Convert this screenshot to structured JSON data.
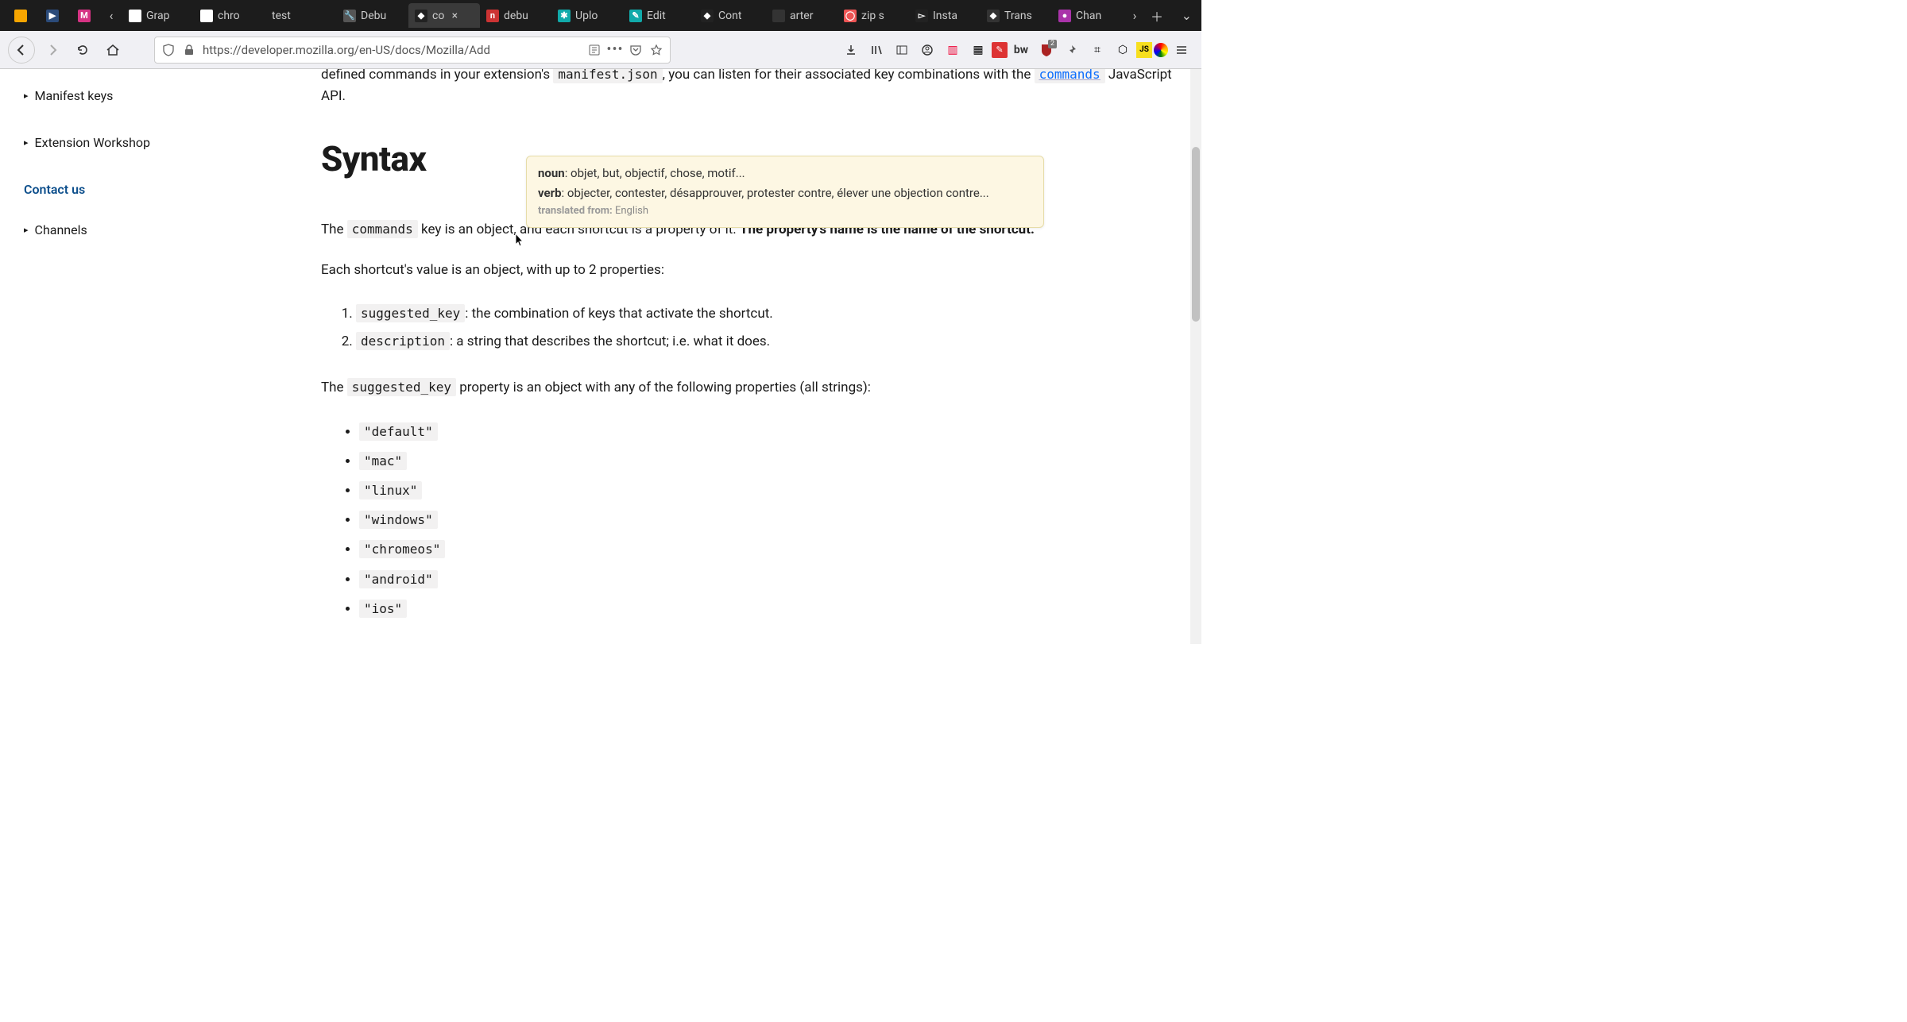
{
  "os_tabs": {
    "pinned": [
      {
        "color": "#f7a500",
        "txt": ""
      },
      {
        "color": "#2b4b7a",
        "txt": "▶"
      },
      {
        "color": "#d63384",
        "txt": "M"
      }
    ],
    "items": [
      {
        "label": "Grap",
        "fav_bg": "#fff",
        "fav_txt": "‹",
        "active": false,
        "closable": false
      },
      {
        "label": "chro",
        "fav_bg": "#fff",
        "fav_txt": "◉",
        "active": false,
        "closable": false
      },
      {
        "label": "test",
        "fav_bg": "",
        "fav_txt": "",
        "active": false,
        "closable": false
      },
      {
        "label": "Debu",
        "fav_bg": "#555",
        "fav_txt": "🔧",
        "active": false,
        "closable": false
      },
      {
        "label": "co",
        "fav_bg": "#222",
        "fav_txt": "◆",
        "active": true,
        "closable": true
      },
      {
        "label": "debu",
        "fav_bg": "#c33",
        "fav_txt": "n",
        "active": false,
        "closable": false
      },
      {
        "label": "Uplo",
        "fav_bg": "#1aa",
        "fav_txt": "✱",
        "active": false,
        "closable": false
      },
      {
        "label": "Edit",
        "fav_bg": "#1aa",
        "fav_txt": "✎",
        "active": false,
        "closable": false
      },
      {
        "label": "Cont",
        "fav_bg": "#222",
        "fav_txt": "◆",
        "active": false,
        "closable": false
      },
      {
        "label": "arter",
        "fav_bg": "#333",
        "fav_txt": "",
        "active": false,
        "closable": false
      },
      {
        "label": "zip s",
        "fav_bg": "#e55",
        "fav_txt": "◯",
        "active": false,
        "closable": false
      },
      {
        "label": "Insta",
        "fav_bg": "#222",
        "fav_txt": "▻",
        "active": false,
        "closable": false
      },
      {
        "label": "Trans",
        "fav_bg": "#333",
        "fav_txt": "◆",
        "active": false,
        "closable": false
      },
      {
        "label": "Chan",
        "fav_bg": "#a3a",
        "fav_txt": "●",
        "active": false,
        "closable": false
      }
    ],
    "overflow_next": "›",
    "new_tab": "＋",
    "dropdown": "⌄"
  },
  "toolbar": {
    "url": "https://developer.mozilla.org/en-US/docs/Mozilla/Add",
    "back": "←",
    "forward": "→",
    "reload": "⟳",
    "home": "⌂",
    "shield": "⛉",
    "lock": "🔒",
    "reader": "☰",
    "ellipsis": "⋯",
    "pocket": "⌄",
    "bookmark": "☆",
    "download": "⬇",
    "library": "⫿",
    "sidebar": "▭",
    "account": "◯",
    "ext_badge": "2"
  },
  "sidebar": {
    "items": [
      {
        "label": "Manifest keys",
        "chev": "▸",
        "link": false
      },
      {
        "label": "Extension Workshop",
        "chev": "▸",
        "link": false
      },
      {
        "label": "Contact us",
        "chev": "",
        "link": true
      },
      {
        "label": "Channels",
        "chev": "▸",
        "link": false
      }
    ]
  },
  "content": {
    "partial_pre": "defined commands in your extension's ",
    "partial_code": "manifest.json",
    "partial_mid": ", you can listen for their associated key combinations with the ",
    "partial_link_code": "commands",
    "partial_post": " JavaScript API.",
    "heading": "Syntax",
    "p1_pre": "The ",
    "p1_code": "commands",
    "p1_mid": " key is an object, and each shortcut is a property of it. ",
    "p1_strong": "The property's name is the name of the shortcut.",
    "p2": "Each shortcut's value is an object, with up to 2 properties:",
    "ol": [
      {
        "code": "suggested_key",
        "text": ": the combination of keys that activate the shortcut."
      },
      {
        "code": "description",
        "text": ": a string that describes the shortcut; i.e. what it does."
      }
    ],
    "p3_pre": "The ",
    "p3_code": "suggested_key",
    "p3_post": " property is an object with any of the following properties (all strings):",
    "ul": [
      "\"default\"",
      "\"mac\"",
      "\"linux\"",
      "\"windows\"",
      "\"chromeos\"",
      "\"android\"",
      "\"ios\""
    ]
  },
  "tooltip": {
    "rows": [
      {
        "pos": "noun",
        "vals": ": objet, but, objectif, chose, motif..."
      },
      {
        "pos": "verb",
        "vals": ": objecter, contester, désapprouver, protester contre, élever une objection contre..."
      }
    ],
    "from_lbl": "translated from: ",
    "from_val": "English"
  }
}
